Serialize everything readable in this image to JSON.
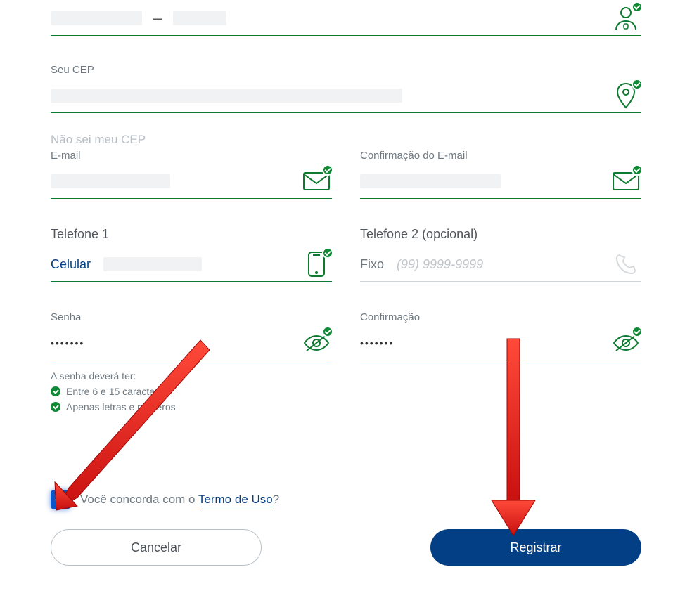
{
  "cpf": {
    "dash": "–"
  },
  "cep": {
    "label": "Seu CEP",
    "unknown_link": "Não sei meu CEP"
  },
  "email": {
    "label": "E-mail"
  },
  "email_confirm": {
    "label": "Confirmação do E-mail"
  },
  "phone1": {
    "section": "Telefone 1",
    "type": "Celular"
  },
  "phone2": {
    "section": "Telefone 2 (opcional)",
    "type": "Fixo",
    "placeholder": "(99) 9999-9999"
  },
  "password": {
    "label": "Senha",
    "masked": "•••••••",
    "hint_title": "A senha deverá ter:",
    "hint1": "Entre 6 e 15 caracteres",
    "hint2": "Apenas letras e números"
  },
  "password_confirm": {
    "label": "Confirmação",
    "masked": "•••••••"
  },
  "terms": {
    "prefix": "Você concorda com o ",
    "link": "Termo de Uso",
    "suffix": "?"
  },
  "buttons": {
    "cancel": "Cancelar",
    "register": "Registrar"
  }
}
